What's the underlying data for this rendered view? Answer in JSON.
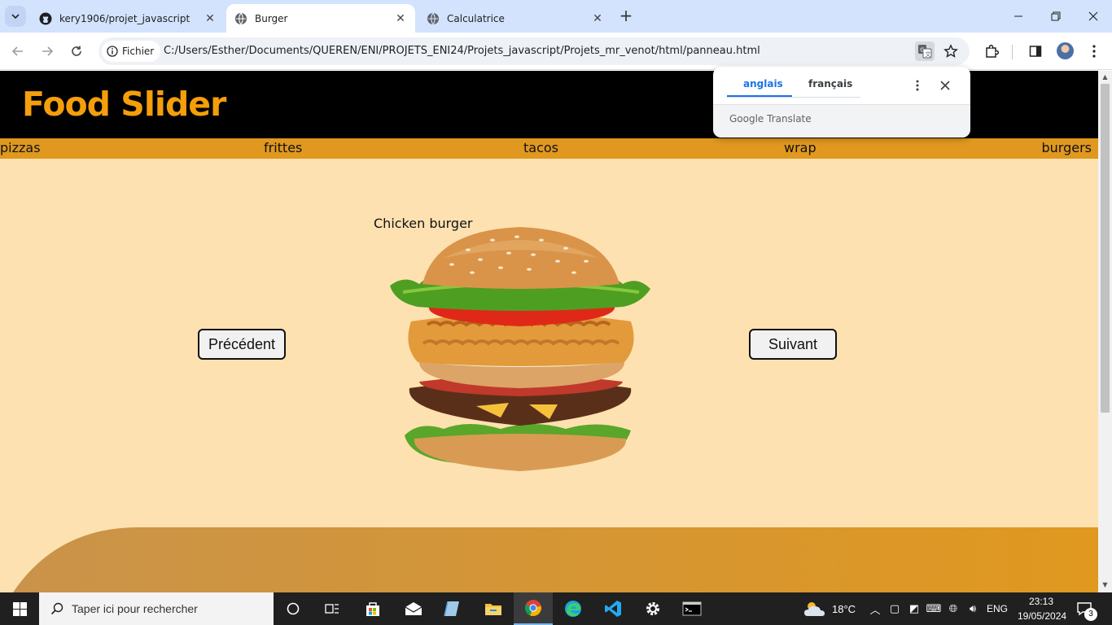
{
  "browser": {
    "tabs": [
      {
        "title": "kery1906/projet_javascript",
        "favicon": "github-icon",
        "active": false
      },
      {
        "title": "Burger",
        "favicon": "globe-icon",
        "active": true
      },
      {
        "title": "Calculatrice",
        "favicon": "globe-icon",
        "active": false
      }
    ],
    "address": {
      "chip_label": "Fichier",
      "url": "C:/Users/Esther/Documents/QUEREN/ENI/PROJETS_ENI24/Projets_javascript/Projets_mr_venot/html/panneau.html"
    }
  },
  "translate_popup": {
    "tabs": [
      "anglais",
      "français"
    ],
    "selected": "anglais",
    "footer_brand": "Google",
    "footer_label": "Translate"
  },
  "page": {
    "title": "Food Slider",
    "menu": [
      "pizzas",
      "frittes",
      "tacos",
      "wrap",
      "burgers"
    ],
    "slide": {
      "caption": "Chicken burger",
      "prev_label": "Précédent",
      "next_label": "Suivant",
      "image": "burger-image"
    },
    "colors": {
      "header_bg": "#000000",
      "title": "#f59e0b",
      "menu_bg": "#e0981f",
      "page_bg": "#fde1b0",
      "wave": "#de9822"
    }
  },
  "taskbar": {
    "search_placeholder": "Taper ici pour rechercher",
    "weather": "18°C",
    "language": "ENG",
    "time": "23:13",
    "date": "19/05/2024",
    "notifications": "3"
  }
}
